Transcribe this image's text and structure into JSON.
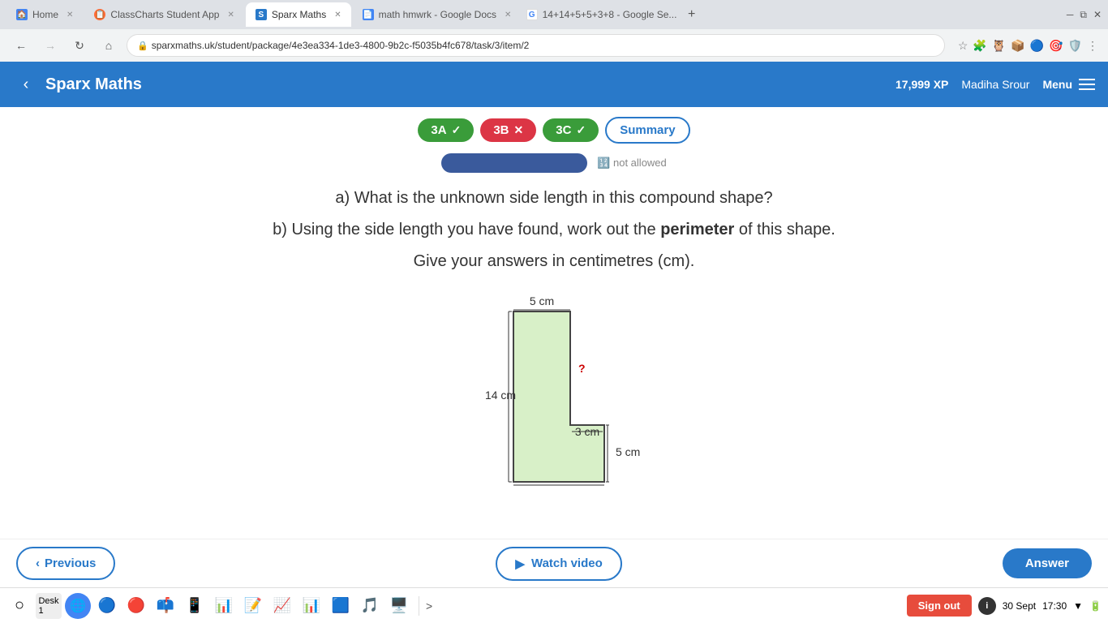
{
  "browser": {
    "tabs": [
      {
        "id": "home",
        "label": "Home",
        "icon": "🏠",
        "active": false
      },
      {
        "id": "classcharts",
        "label": "ClassCharts Student App",
        "icon": "📋",
        "active": false
      },
      {
        "id": "sparx",
        "label": "Sparx Maths",
        "icon": "S",
        "active": true
      },
      {
        "id": "docs",
        "label": "math hmwrk - Google Docs",
        "icon": "📄",
        "active": false
      },
      {
        "id": "google",
        "label": "14+14+5+5+3+8 - Google Se...",
        "icon": "G",
        "active": false
      }
    ],
    "url": "sparxmaths.uk/student/package/4e3ea334-1de3-4800-9b2c-f5035b4fc678/task/3/item/2",
    "new_tab_label": "+"
  },
  "header": {
    "back_label": "‹",
    "logo": "Sparx Maths",
    "xp": "17,999 XP",
    "username": "Madiha Srour",
    "menu_label": "Menu"
  },
  "tabs": [
    {
      "id": "3a",
      "label": "3A",
      "status": "correct",
      "icon": "✓"
    },
    {
      "id": "3b",
      "label": "3B",
      "status": "incorrect",
      "icon": "✕"
    },
    {
      "id": "3c",
      "label": "3C",
      "status": "correct",
      "icon": "✓"
    },
    {
      "id": "summary",
      "label": "Summary",
      "status": "summary"
    }
  ],
  "question": {
    "part_a": "a) What is the unknown side length in this compound shape?",
    "part_b_prefix": "b) Using the side length you have found, work out the ",
    "part_b_bold": "perimeter",
    "part_b_suffix": " of this shape.",
    "units_note": "Give your answers in centimetres (cm).",
    "shape": {
      "label_top": "5 cm",
      "label_left": "14 cm",
      "label_bottom_inner": "3 cm",
      "label_right_bottom": "5 cm",
      "label_unknown": "?"
    }
  },
  "bottom_bar": {
    "previous_label": "Previous",
    "watch_video_label": "Watch video",
    "answer_label": "Answer"
  },
  "taskbar": {
    "desk_label": "Desk 1",
    "more_label": ">",
    "sign_out_label": "Sign out",
    "date_label": "30 Sept",
    "time_label": "17:30"
  }
}
